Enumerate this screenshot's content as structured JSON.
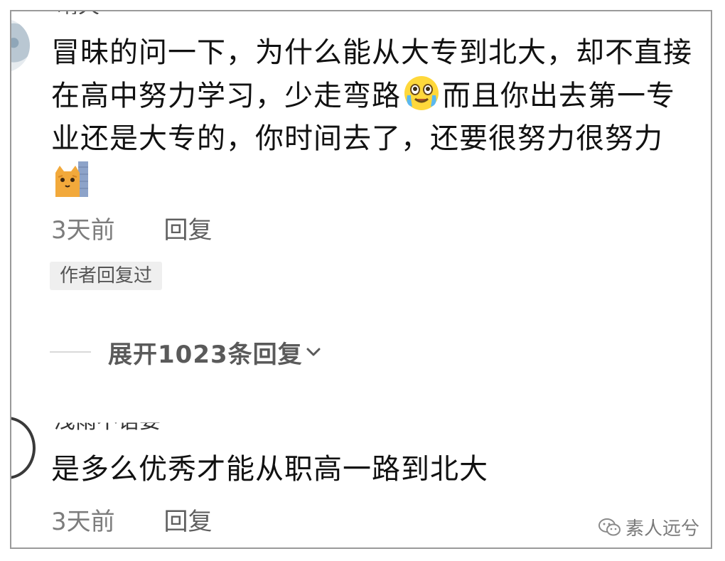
{
  "comments": [
    {
      "username_clipped": "晴天",
      "text_before_emoji1": "冒昧的问一下，为什么能从大专到北大，却不直接在高中努力学习，少走弯路",
      "emoji1": "crying-laughing-emoji",
      "text_after_emoji1": "而且你出去第一专业还是大专的，你时间去了，还要很努力很努力",
      "emoji2": "cat-peeking-emoji",
      "time": "3天前",
      "reply_label": "回复",
      "author_replied_tag": "作者回复过"
    },
    {
      "username_clipped": "浅雨不语要",
      "text": "是多么优秀才能从职高一路到北大",
      "time": "3天前",
      "reply_label": "回复"
    }
  ],
  "expand_replies": {
    "label": "展开1023条回复",
    "icon": "chevron-down-icon"
  },
  "watermark": {
    "text": "素人远兮",
    "icon": "wechat-icon"
  }
}
